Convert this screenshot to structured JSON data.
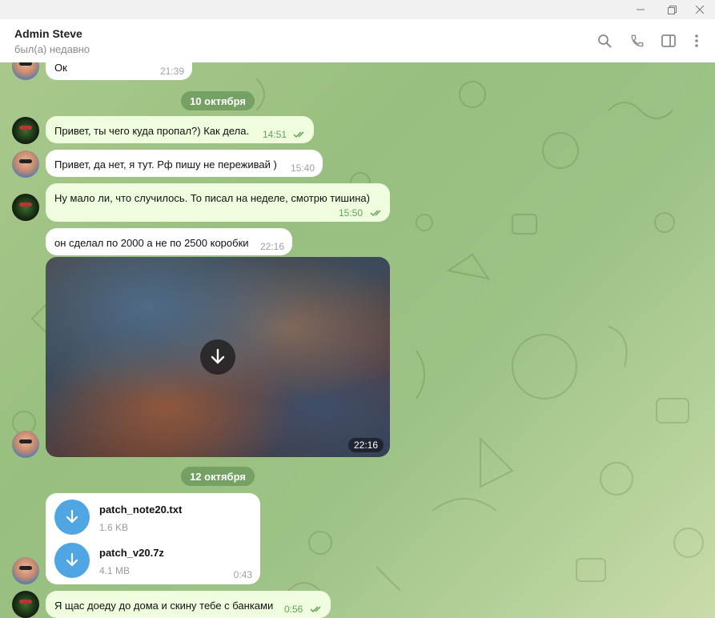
{
  "window": {
    "minimize_icon": "minimize-icon",
    "restore_icon": "restore-icon",
    "close_icon": "close-icon"
  },
  "header": {
    "name": "Admin Steve",
    "status": "был(а) недавно",
    "icons": [
      "search-icon",
      "phone-icon",
      "sidebar-toggle-icon",
      "more-icon"
    ]
  },
  "colors": {
    "chat_bg": "#9fc486",
    "bubble_out": "#effdde",
    "bubble_in": "#ffffff",
    "date_pill": "#6b9a5c",
    "file_icon": "#4fa6e3",
    "read_check": "#5fa45a"
  },
  "messages": {
    "m0": {
      "text": "Ок",
      "time": "21:39"
    },
    "date1": "10 октября",
    "m1": {
      "text": "Привет, ты чего куда пропал?) Как дела.",
      "time": "14:51"
    },
    "m2": {
      "text": "Привет, да нет, я тут. Рф пишу не переживай )",
      "time": "15:40"
    },
    "m3": {
      "text": "Ну мало ли, что случилось. То писал на неделе, смотрю тишина)",
      "time": "15:50"
    },
    "m4": {
      "text": "он сделал по 2000 а не по 2500 коробки",
      "time": "22:16"
    },
    "m5": {
      "media_time": "22:16"
    },
    "date2": "12 октября",
    "files": [
      {
        "name": "patch_note20.txt",
        "size": "1.6 KB"
      },
      {
        "name": "patch_v20.7z",
        "size": "4.1 MB"
      }
    ],
    "files_time": "0:43",
    "m6": {
      "text": "Я щас доеду до дома и скину тебе с банками",
      "time": "0:56"
    }
  }
}
